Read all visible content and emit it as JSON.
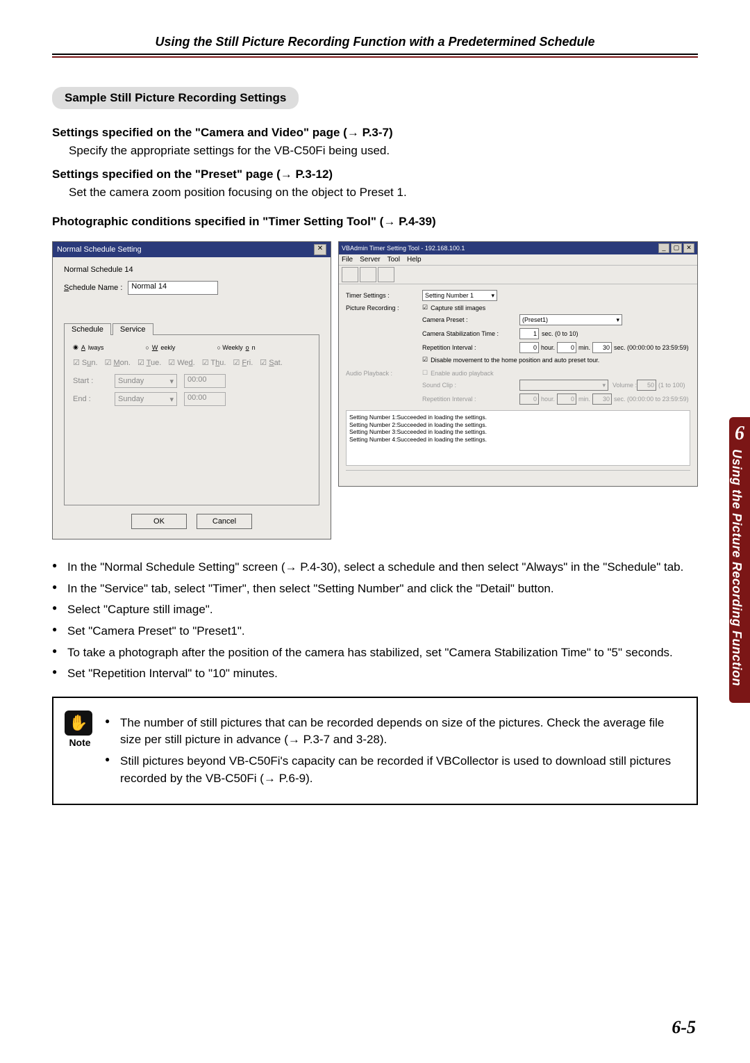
{
  "running_head": "Using the Still Picture Recording Function with a Predetermined Schedule",
  "pill": "Sample Still Picture Recording Settings",
  "sec1_head": "Settings specified on the \"Camera and Video\" page (→ P.3-7)",
  "sec1_body": "Specify the appropriate settings for the VB-C50Fi being used.",
  "sec2_head": "Settings specified on the \"Preset\" page (→ P.3-12)",
  "sec2_body": "Set the camera zoom position focusing on the object to Preset 1.",
  "sec3_head": "Photographic conditions specified in \"Timer Setting Tool\" (→ P.4-39)",
  "dlg": {
    "title": "Normal Schedule Setting",
    "heading": "Normal Schedule 14",
    "name_label": "Schedule Name :",
    "name_value": "Normal 14",
    "tab_schedule": "Schedule",
    "tab_service": "Service",
    "opt_always": "Always",
    "opt_weekly": "Weekly",
    "opt_weekly_on": "Weekly on",
    "days": [
      "Sun.",
      "Mon.",
      "Tue.",
      "Wed.",
      "Thu.",
      "Fri.",
      "Sat."
    ],
    "start_label": "Start :",
    "end_label": "End :",
    "day_value": "Sunday",
    "time_value": "00:00",
    "ok": "OK",
    "cancel": "Cancel"
  },
  "tt": {
    "title": "VBAdmin Timer Setting Tool - 192.168.100.1",
    "menu": [
      "File",
      "Server",
      "Tool",
      "Help"
    ],
    "timer_settings_label": "Timer Settings :",
    "setting_number": "Setting Number 1",
    "picture_recording_label": "Picture Recording :",
    "capture_chk": "Capture still images",
    "camera_preset_label": "Camera Preset :",
    "camera_preset_value": "(Preset1)",
    "stab_label": "Camera Stabilization Time :",
    "stab_value": "1",
    "stab_hint": "sec. (0 to 10)",
    "rep_label": "Repetition Interval :",
    "rep_h": "0",
    "rep_m": "0",
    "rep_s": "30",
    "rep_hint": "sec. (00:00:00 to 23:59:59)",
    "disable_move": "Disable movement to the home position and auto preset tour.",
    "audio_label": "Audio Playback :",
    "audio_enable": "Enable audio playback",
    "sound_clip_label": "Sound Clip :",
    "volume_label": "Volume :",
    "volume_value": "50",
    "volume_hint": "(1 to 100)",
    "audio_rep_label": "Repetition Interval :",
    "audio_rep_hint": "sec. (00:00:00 to 23:59:59)",
    "status": [
      "Setting Number 1:Succeeded in loading the settings.",
      "Setting Number 2:Succeeded in loading the settings.",
      "Setting Number 3:Succeeded in loading the settings.",
      "Setting Number 4:Succeeded in loading the settings."
    ]
  },
  "bullets": [
    "In the \"Normal Schedule Setting\" screen (→ P.4-30), select a schedule and then select \"Always\" in the \"Schedule\" tab.",
    "In the \"Service\" tab, select \"Timer\", then select \"Setting Number\" and click the \"Detail\" button.",
    "Select \"Capture still image\".",
    "Set \"Camera Preset\" to \"Preset1\".",
    "To take a photograph after the position of the camera has stabilized, set \"Camera Stabilization Time\" to \"5\" seconds.",
    "Set \"Repetition Interval\" to \"10\" minutes."
  ],
  "note": {
    "label": "Note",
    "items": [
      "The number of still pictures that can be recorded depends on size of the pictures. Check the average file size per still picture in advance (→ P.3-7 and 3-28).",
      "Still pictures beyond VB-C50Fi's capacity can be recorded if VBCollector is used to download still pictures recorded by the VB-C50Fi (→ P.6-9)."
    ]
  },
  "sidetab": {
    "num": "6",
    "text": "Using the Picture Recording Function"
  },
  "pagenum": "6-5"
}
